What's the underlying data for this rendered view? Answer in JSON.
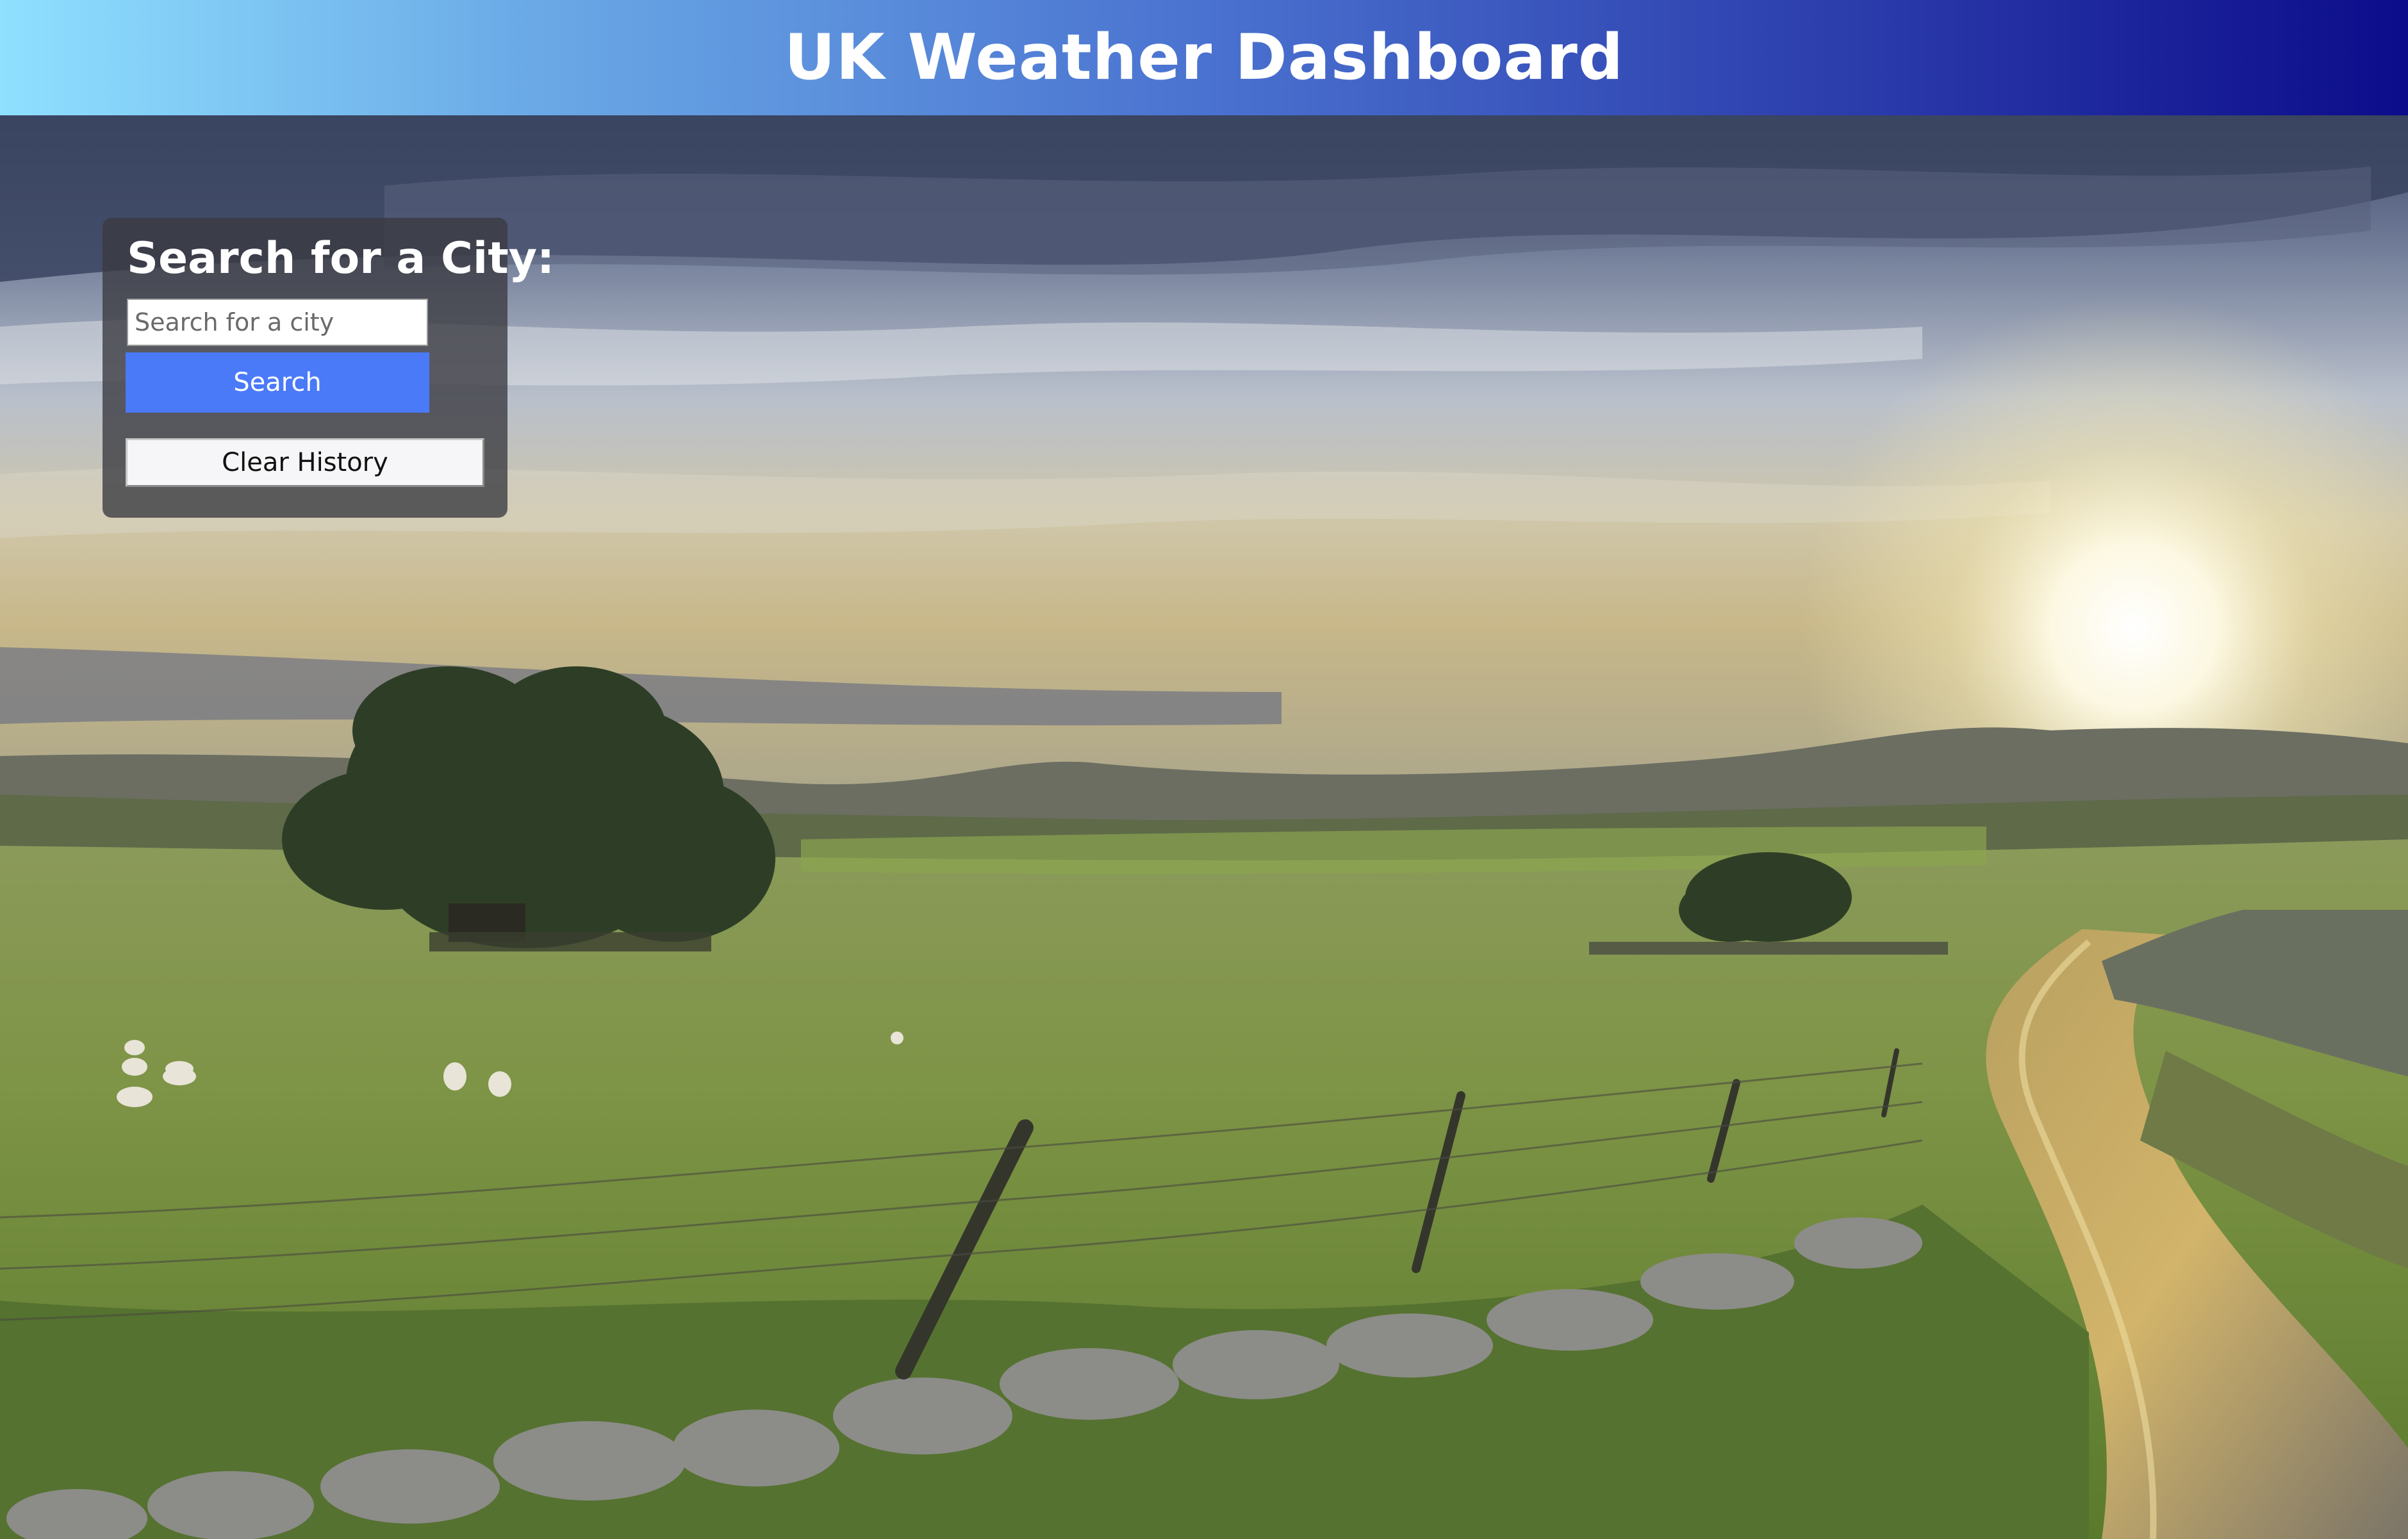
{
  "header": {
    "title": "UK Weather Dashboard"
  },
  "search": {
    "heading": "Search for a City:",
    "placeholder": "Search for a city",
    "value": "",
    "search_label": "Search",
    "clear_label": "Clear History"
  },
  "background": {
    "description_icon": "countryside-landscape-photo"
  },
  "colors": {
    "header_gradient_start": "#8fe0ff",
    "header_gradient_end": "#0c0c8a",
    "search_button": "#4a7af8",
    "panel": "#3a3a40"
  }
}
